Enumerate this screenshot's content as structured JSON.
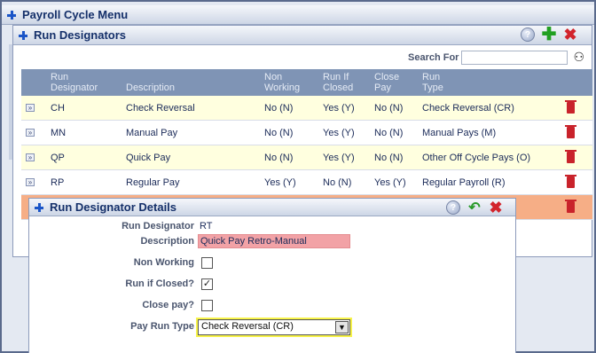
{
  "top_panel": {
    "title": "Payroll Cycle Menu"
  },
  "run_designators": {
    "title": "Run Designators",
    "search": {
      "label": "Search For",
      "value": ""
    },
    "columns": [
      {
        "line1": "Run",
        "line2": "Designator"
      },
      {
        "line1": "",
        "line2": "Description"
      },
      {
        "line1": "Non",
        "line2": "Working"
      },
      {
        "line1": "Run If",
        "line2": "Closed"
      },
      {
        "line1": "Close",
        "line2": "Pay"
      },
      {
        "line1": "Run",
        "line2": "Type"
      }
    ],
    "rows": [
      {
        "code": "CH",
        "description": "Check Reversal",
        "non_working": "No (N)",
        "run_if_closed": "Yes (Y)",
        "close_pay": "No (N)",
        "run_type": "Check Reversal (CR)"
      },
      {
        "code": "MN",
        "description": "Manual Pay",
        "non_working": "No (N)",
        "run_if_closed": "Yes (Y)",
        "close_pay": "No (N)",
        "run_type": "Manual Pays (M)"
      },
      {
        "code": "QP",
        "description": "Quick Pay",
        "non_working": "No (N)",
        "run_if_closed": "Yes (Y)",
        "close_pay": "No (N)",
        "run_type": "Other Off Cycle Pays (O)"
      },
      {
        "code": "RP",
        "description": "Regular Pay",
        "non_working": "Yes (Y)",
        "run_if_closed": "No (N)",
        "close_pay": "Yes (Y)",
        "run_type": "Regular Payroll (R)"
      }
    ],
    "row_colors": [
      "#ffffdf",
      "#ffffff",
      "#ffffdf",
      "#ffffff"
    ],
    "selected_row_color": "#f6ae86"
  },
  "details": {
    "title": "Run Designator Details",
    "fields": {
      "run_designator": {
        "label": "Run Designator",
        "value": "RT"
      },
      "description": {
        "label": "Description",
        "value": "Quick Pay Retro-Manual"
      },
      "non_working": {
        "label": "Non Working",
        "checked": false
      },
      "run_if_closed": {
        "label": "Run if Closed?",
        "checked": true
      },
      "close_pay": {
        "label": "Close pay?",
        "checked": false
      },
      "pay_run_type": {
        "label": "Pay Run Type",
        "value": "Check Reversal (CR)"
      }
    }
  },
  "icons": {
    "help": "help-icon",
    "add": "add-icon",
    "delete": "delete-icon",
    "search": "binoculars-icon",
    "expand": "expand-row-icon",
    "trash": "trash-icon",
    "undo": "undo-icon"
  },
  "colors": {
    "header_bg": "#7f94b5",
    "accent": "#1b55c7",
    "delete": "#d2242c",
    "description_highlight": "#f2a2a6",
    "select_highlight": "#f7f34a"
  }
}
